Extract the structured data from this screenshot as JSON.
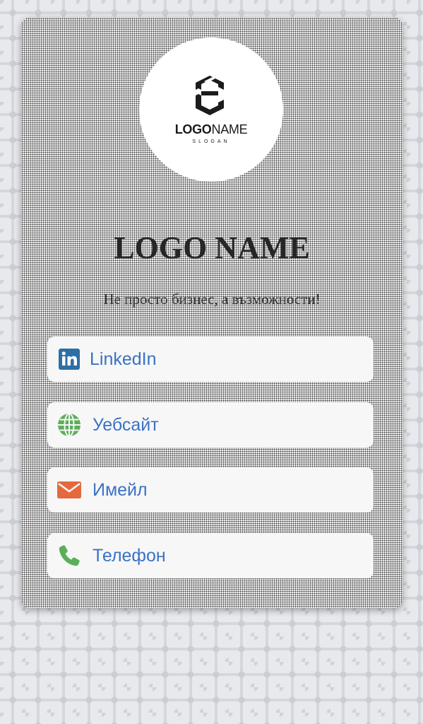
{
  "logo": {
    "word_bold": "LOGO",
    "word_light": "NAME",
    "slogan": "SLOGAN"
  },
  "title": "LOGO NAME",
  "subtitle": "Не просто бизнес, а възможности!",
  "links": [
    {
      "label": "LinkedIn",
      "icon": "linkedin-icon",
      "color": "#2e6ea6"
    },
    {
      "label": "Уебсайт",
      "icon": "globe-icon",
      "color": "#5cae5a"
    },
    {
      "label": "Имейл",
      "icon": "envelope-icon",
      "color": "#e4693f"
    },
    {
      "label": "Телефон",
      "icon": "phone-icon",
      "color": "#5cae5a"
    }
  ],
  "colors": {
    "link_text": "#3a72c6",
    "title_text": "#262626"
  }
}
